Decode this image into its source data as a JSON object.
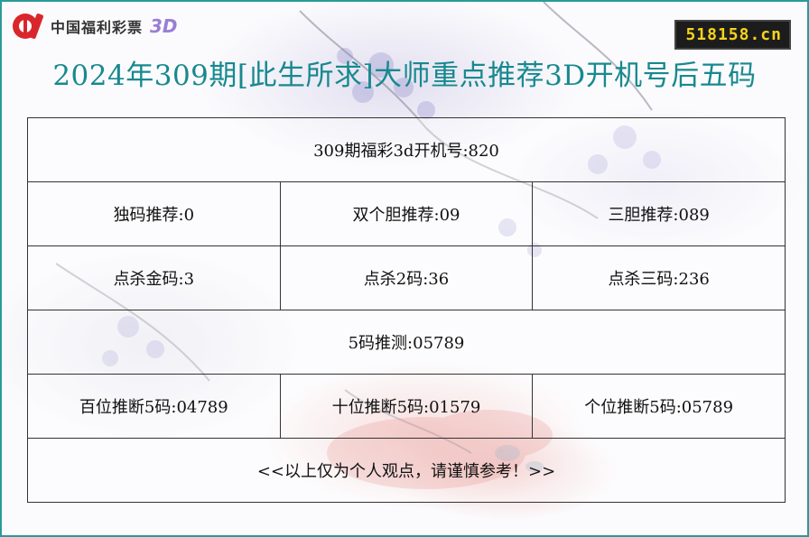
{
  "logo": {
    "text": "中国福利彩票",
    "suffix": "3D"
  },
  "site_badge": "518158.cn",
  "title": "2024年309期[此生所求]大师重点推荐3D开机号后五码",
  "table": {
    "row1": "309期福彩3d开机号:820",
    "row2": [
      "独码推荐:0",
      "双个胆推荐:09",
      "三胆推荐:089"
    ],
    "row3": [
      "点杀金码:3",
      "点杀2码:36",
      "点杀三码:236"
    ],
    "row4": "5码推测:05789",
    "row5": [
      "百位推断5码:04789",
      "十位推断5码:01579",
      "个位推断5码:05789"
    ],
    "row6": "<<以上仅为个人观点，请谨慎参考！>>"
  },
  "colors": {
    "title": "#17898f",
    "border": "#2a9a9a",
    "badge_bg": "#1c1c1c",
    "badge_text": "#f6d21c",
    "logo_red": "#d9262c",
    "logo_3d": "#9a7ed4"
  }
}
